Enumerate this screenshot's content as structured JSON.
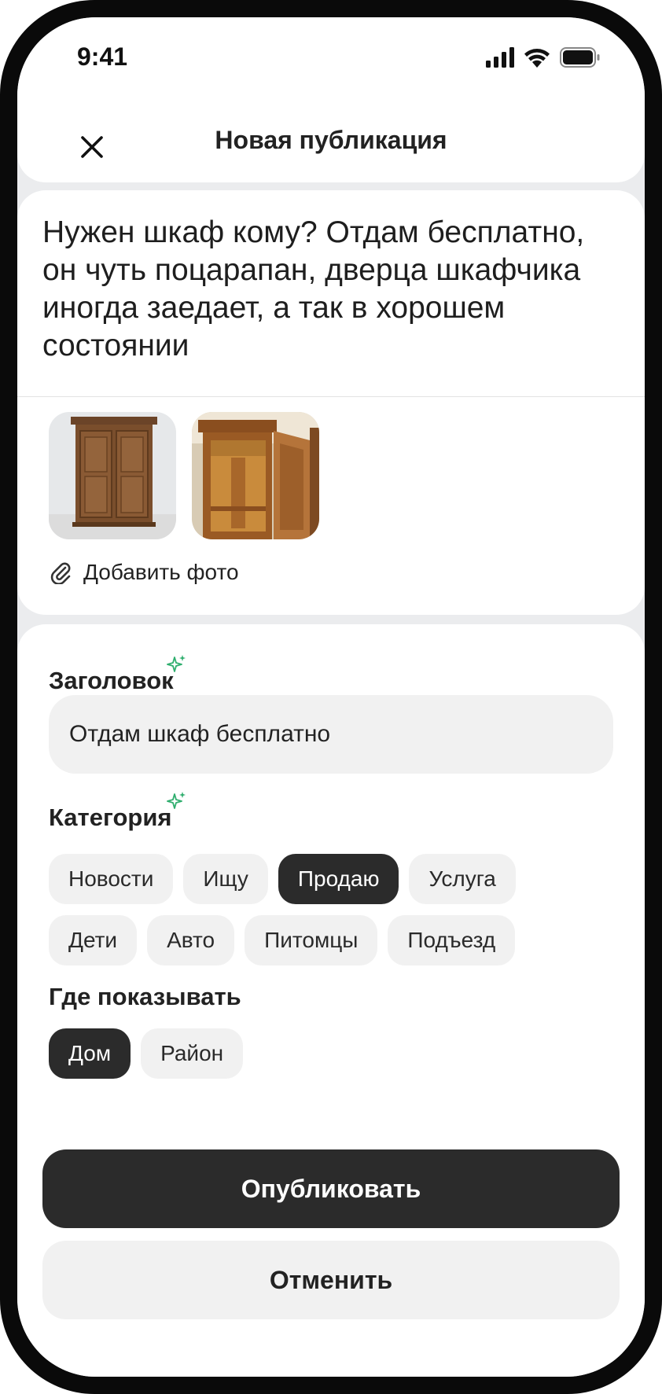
{
  "status_bar": {
    "time": "9:41",
    "icons": [
      "signal-icon",
      "wifi-icon",
      "battery-icon"
    ]
  },
  "header": {
    "title": "Новая публикация",
    "close_icon": "close-icon"
  },
  "post": {
    "text": "Нужен шкаф кому? Отдам бесплатно, он чуть поцарапан, дверца шкафчика иногда заедает, а так в хорошем состоянии",
    "photos": [
      "wardrobe-photo-closed",
      "wardrobe-photo-open"
    ],
    "add_photo_label": "Добавить фото",
    "add_photo_icon": "paperclip-icon"
  },
  "form": {
    "title_label": "Заголовок",
    "title_value": "Отдам шкаф бесплатно",
    "category_label": "Категория",
    "categories_row1": [
      "Новости",
      "Ищу",
      "Продаю",
      "Услуга"
    ],
    "categories_row2": [
      "Дети",
      "Авто",
      "Питомцы",
      "Подъезд"
    ],
    "selected_category": "Продаю",
    "where_label": "Где показывать",
    "where_options": [
      "Дом",
      "Район"
    ],
    "selected_where": "Дом",
    "sparkle_icon": "sparkle-icon"
  },
  "actions": {
    "publish_label": "Опубликовать",
    "cancel_label": "Отменить"
  },
  "colors": {
    "dark": "#2b2b2b",
    "chip_bg": "#f1f1f1",
    "page_bg": "#ebecee",
    "sparkle": "#2fae6e"
  }
}
